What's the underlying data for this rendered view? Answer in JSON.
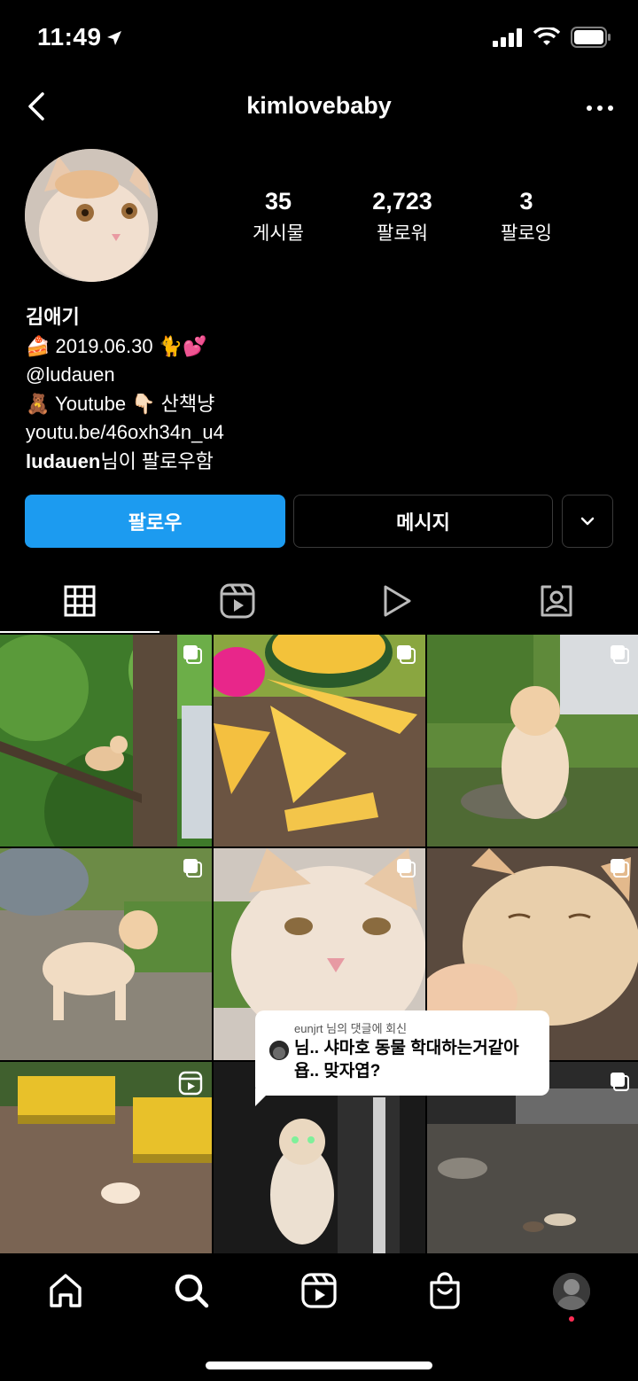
{
  "status_bar": {
    "time": "11:49"
  },
  "header": {
    "username": "kimlovebaby"
  },
  "profile": {
    "stats": [
      {
        "value": "35",
        "label": "게시물"
      },
      {
        "value": "2,723",
        "label": "팔로워"
      },
      {
        "value": "3",
        "label": "팔로잉"
      }
    ],
    "bio": {
      "name": "김애기",
      "line1": "🍰 2019.06.30 🐈💕",
      "line2": "@ludauen",
      "line3": "🧸 Youtube 👇🏻  산책냥",
      "line4": "youtu.be/46oxh34n_u4",
      "followed_by_user": "ludauen",
      "followed_by_suffix": "님이 팔로우함"
    }
  },
  "actions": {
    "follow_label": "팔로우",
    "message_label": "메시지"
  },
  "tabs": [
    {
      "name": "posts-grid",
      "icon": "grid-icon",
      "active": true
    },
    {
      "name": "reels",
      "icon": "reels-icon",
      "active": false
    },
    {
      "name": "videos",
      "icon": "play-icon",
      "active": false
    },
    {
      "name": "tagged",
      "icon": "tagged-person-icon",
      "active": false
    }
  ],
  "grid": {
    "posts": [
      {
        "subject": "cat in tree",
        "badge": "multi-photo-icon"
      },
      {
        "subject": "yellow watermelon slices",
        "badge": "multi-photo-icon"
      },
      {
        "subject": "cat sitting outdoors",
        "badge": "multi-photo-icon"
      },
      {
        "subject": "cat on path",
        "badge": "multi-photo-icon"
      },
      {
        "subject": "cat face closeup",
        "badge": "multi-photo-icon"
      },
      {
        "subject": "cat being petted",
        "badge": "multi-photo-icon"
      },
      {
        "subject": "yellow benches with cat",
        "badge": "reels-icon"
      },
      {
        "subject": "cat at night",
        "badge": "multi-photo-icon"
      },
      {
        "subject": "cats on pavement at night",
        "badge": "multi-photo-icon"
      }
    ]
  },
  "comment_overlay": {
    "meta": "eunjrt 님의 댓글에 회신",
    "text": "님.. 샤마호 동물 학대하는거같아욥.. 맞자엽?"
  },
  "bottom_nav": [
    {
      "name": "home",
      "icon": "home-icon"
    },
    {
      "name": "search",
      "icon": "search-icon"
    },
    {
      "name": "reels",
      "icon": "reels-icon"
    },
    {
      "name": "shop",
      "icon": "shop-bag-icon"
    },
    {
      "name": "profile",
      "icon": "profile-avatar"
    }
  ],
  "colors": {
    "background": "#000000",
    "follow_button": "#1c9bf0",
    "notification_dot": "#ff2d55"
  }
}
